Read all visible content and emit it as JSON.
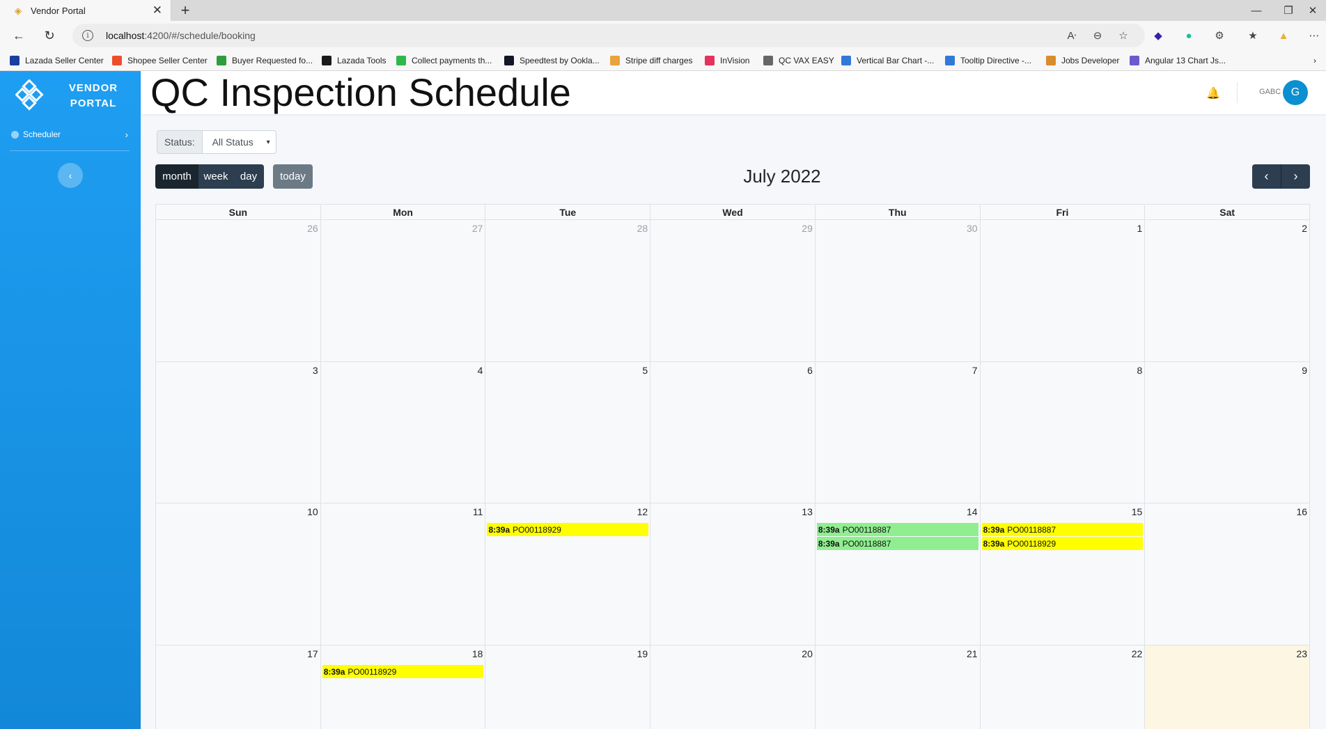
{
  "browser": {
    "tab_title": "Vendor Portal",
    "url_host": "localhost",
    "url_path": ":4200/#/schedule/booking",
    "bookmarks": [
      {
        "label": "Lazada Seller Center",
        "color": "#1b3fa0"
      },
      {
        "label": "Shopee Seller Center",
        "color": "#ee4d2d"
      },
      {
        "label": "Buyer Requested fo...",
        "color": "#2e9d3d"
      },
      {
        "label": "Lazada Tools",
        "color": "#1a1a1a"
      },
      {
        "label": "Collect payments th...",
        "color": "#2eb84b"
      },
      {
        "label": "Speedtest by Ookla...",
        "color": "#141526"
      },
      {
        "label": "Stripe diff charges",
        "color": "#e8a33d"
      },
      {
        "label": "InVision",
        "color": "#e6325a"
      },
      {
        "label": "QC VAX EASY",
        "color": "#666666"
      },
      {
        "label": "Vertical Bar Chart -...",
        "color": "#3079d8"
      },
      {
        "label": "Tooltip Directive -...",
        "color": "#3079d8"
      },
      {
        "label": "Jobs Developer",
        "color": "#d98c2b"
      },
      {
        "label": "Angular 13 Chart Js...",
        "color": "#6a5acd"
      }
    ]
  },
  "sidebar": {
    "brand_line1": "VENDOR",
    "brand_line2": "PORTAL",
    "items": [
      {
        "label": "Scheduler"
      }
    ]
  },
  "header": {
    "title": "QC Inspection Schedule",
    "user_name": "GABC",
    "avatar_initial": "G"
  },
  "filter": {
    "label": "Status:",
    "selected": "All Status"
  },
  "toolbar": {
    "views": [
      "month",
      "week",
      "day"
    ],
    "active_view": "month",
    "today_label": "today",
    "title": "July 2022"
  },
  "calendar": {
    "day_names": [
      "Sun",
      "Mon",
      "Tue",
      "Wed",
      "Thu",
      "Fri",
      "Sat"
    ],
    "weeks": [
      [
        {
          "n": "26",
          "other": true
        },
        {
          "n": "27",
          "other": true
        },
        {
          "n": "28",
          "other": true
        },
        {
          "n": "29",
          "other": true
        },
        {
          "n": "30",
          "other": true
        },
        {
          "n": "1"
        },
        {
          "n": "2"
        }
      ],
      [
        {
          "n": "3"
        },
        {
          "n": "4"
        },
        {
          "n": "5"
        },
        {
          "n": "6"
        },
        {
          "n": "7"
        },
        {
          "n": "8"
        },
        {
          "n": "9"
        }
      ],
      [
        {
          "n": "10"
        },
        {
          "n": "11"
        },
        {
          "n": "12",
          "events": [
            {
              "time": "8:39a",
              "title": "PO00118929",
              "color": "yellow"
            }
          ]
        },
        {
          "n": "13"
        },
        {
          "n": "14",
          "events": [
            {
              "time": "8:39a",
              "title": "PO00118887",
              "color": "green"
            },
            {
              "time": "8:39a",
              "title": "PO00118887",
              "color": "green"
            }
          ]
        },
        {
          "n": "15",
          "events": [
            {
              "time": "8:39a",
              "title": "PO00118887",
              "color": "yellow"
            },
            {
              "time": "8:39a",
              "title": "PO00118929",
              "color": "yellow"
            }
          ]
        },
        {
          "n": "16"
        }
      ],
      [
        {
          "n": "17"
        },
        {
          "n": "18",
          "events": [
            {
              "time": "8:39a",
              "title": "PO00118929",
              "color": "yellow"
            }
          ]
        },
        {
          "n": "19"
        },
        {
          "n": "20"
        },
        {
          "n": "21"
        },
        {
          "n": "22"
        },
        {
          "n": "23",
          "today": true
        }
      ]
    ]
  }
}
